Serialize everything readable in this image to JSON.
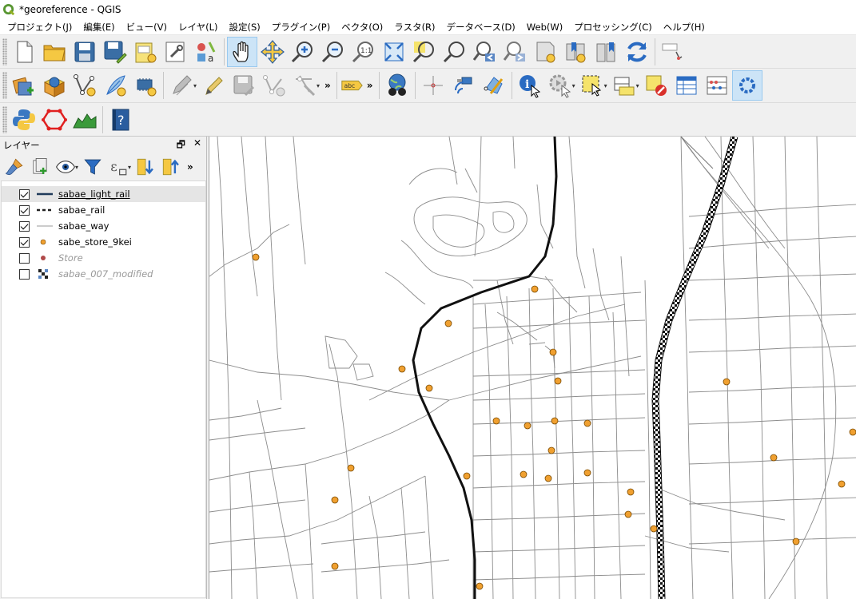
{
  "window": {
    "title": "*georeference - QGIS"
  },
  "menu": [
    "プロジェクト(J)",
    "編集(E)",
    "ビュー(V)",
    "レイヤ(L)",
    "設定(S)",
    "プラグイン(P)",
    "ベクタ(O)",
    "ラスタ(R)",
    "データベース(D)",
    "Web(W)",
    "プロセッシング(C)",
    "ヘルプ(H)"
  ],
  "toolbar": {
    "label_tool_text": "abc",
    "overflow_glyph": "»"
  },
  "layers_panel": {
    "title": "レイヤー",
    "float_glyph": "🗗",
    "close_glyph": "✕",
    "layers": [
      {
        "name": "sabae_light_rail",
        "checked": true,
        "symbol": "line-solid-thick",
        "selected": true
      },
      {
        "name": "sabae_rail",
        "checked": true,
        "symbol": "line-dashed"
      },
      {
        "name": "sabae_way",
        "checked": true,
        "symbol": "line-thin"
      },
      {
        "name": "sabe_store_9kei",
        "checked": true,
        "symbol": "point-orange"
      },
      {
        "name": "Store",
        "checked": false,
        "symbol": "point-red"
      },
      {
        "name": "sabae_007_modified",
        "checked": false,
        "symbol": "raster-checker"
      }
    ]
  },
  "colors": {
    "store_point": "#f0a030",
    "store_point_outline": "#7a4a00",
    "road": "#8c8c8c",
    "light_rail": "#111111",
    "selection": "#cce4f7",
    "store_layer_symbol": "#b04a4a"
  }
}
